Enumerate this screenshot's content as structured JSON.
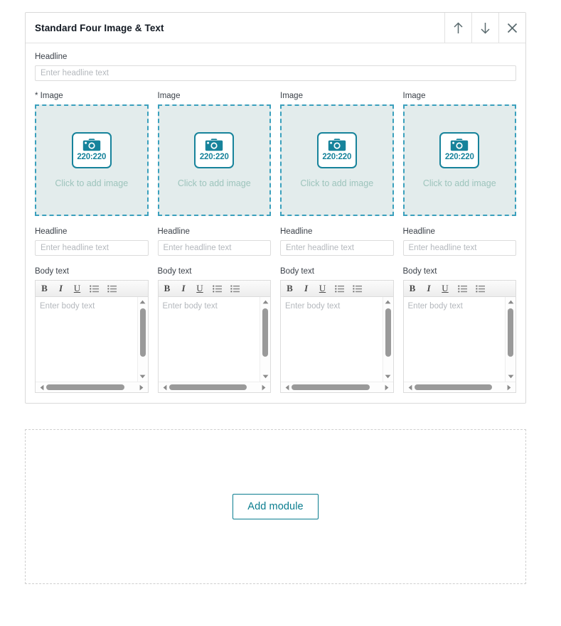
{
  "module": {
    "title": "Standard Four Image & Text",
    "header_actions": [
      {
        "name": "move-up",
        "icon": "arrow-up-icon",
        "label": "Move module up"
      },
      {
        "name": "move-down",
        "icon": "arrow-down-icon",
        "label": "Move module down"
      },
      {
        "name": "remove",
        "icon": "close-icon",
        "label": "Remove module"
      }
    ],
    "main_headline": {
      "label": "Headline",
      "value": "",
      "placeholder": "Enter headline text"
    },
    "columns": [
      {
        "image": {
          "label": "* Image",
          "required": true,
          "ratio": "220:220",
          "cta": "Click to add image",
          "icon": "camera-icon"
        },
        "headline": {
          "label": "Headline",
          "value": "",
          "placeholder": "Enter headline text"
        },
        "body": {
          "label": "Body text",
          "value": "",
          "placeholder": "Enter body text"
        }
      },
      {
        "image": {
          "label": "Image",
          "required": false,
          "ratio": "220:220",
          "cta": "Click to add image",
          "icon": "camera-icon"
        },
        "headline": {
          "label": "Headline",
          "value": "",
          "placeholder": "Enter headline text"
        },
        "body": {
          "label": "Body text",
          "value": "",
          "placeholder": "Enter body text"
        }
      },
      {
        "image": {
          "label": "Image",
          "required": false,
          "ratio": "220:220",
          "cta": "Click to add image",
          "icon": "camera-icon"
        },
        "headline": {
          "label": "Headline",
          "value": "",
          "placeholder": "Enter headline text"
        },
        "body": {
          "label": "Body text",
          "value": "",
          "placeholder": "Enter body text"
        }
      },
      {
        "image": {
          "label": "Image",
          "required": false,
          "ratio": "220:220",
          "cta": "Click to add image",
          "icon": "camera-icon"
        },
        "headline": {
          "label": "Headline",
          "value": "",
          "placeholder": "Enter headline text"
        },
        "body": {
          "label": "Body text",
          "value": "",
          "placeholder": "Enter body text"
        }
      }
    ],
    "editor_toolbar": [
      {
        "name": "bold",
        "label": "B",
        "icon": "bold-icon"
      },
      {
        "name": "italic",
        "label": "I",
        "icon": "italic-icon"
      },
      {
        "name": "underline",
        "label": "U",
        "icon": "underline-icon"
      },
      {
        "name": "bulleted-list",
        "label": "",
        "icon": "bulleted-list-icon"
      },
      {
        "name": "numbered-list",
        "label": "",
        "icon": "numbered-list-icon"
      }
    ]
  },
  "add_module": {
    "label": "Add module"
  },
  "colors": {
    "accent_teal": "#17839b",
    "dropzone_border": "#3aa0bd",
    "dropzone_fill": "#e3ecec",
    "cta_text": "#9dc4bc",
    "button_border": "#0a7d8f",
    "icon_gray": "#5a6a6e"
  }
}
